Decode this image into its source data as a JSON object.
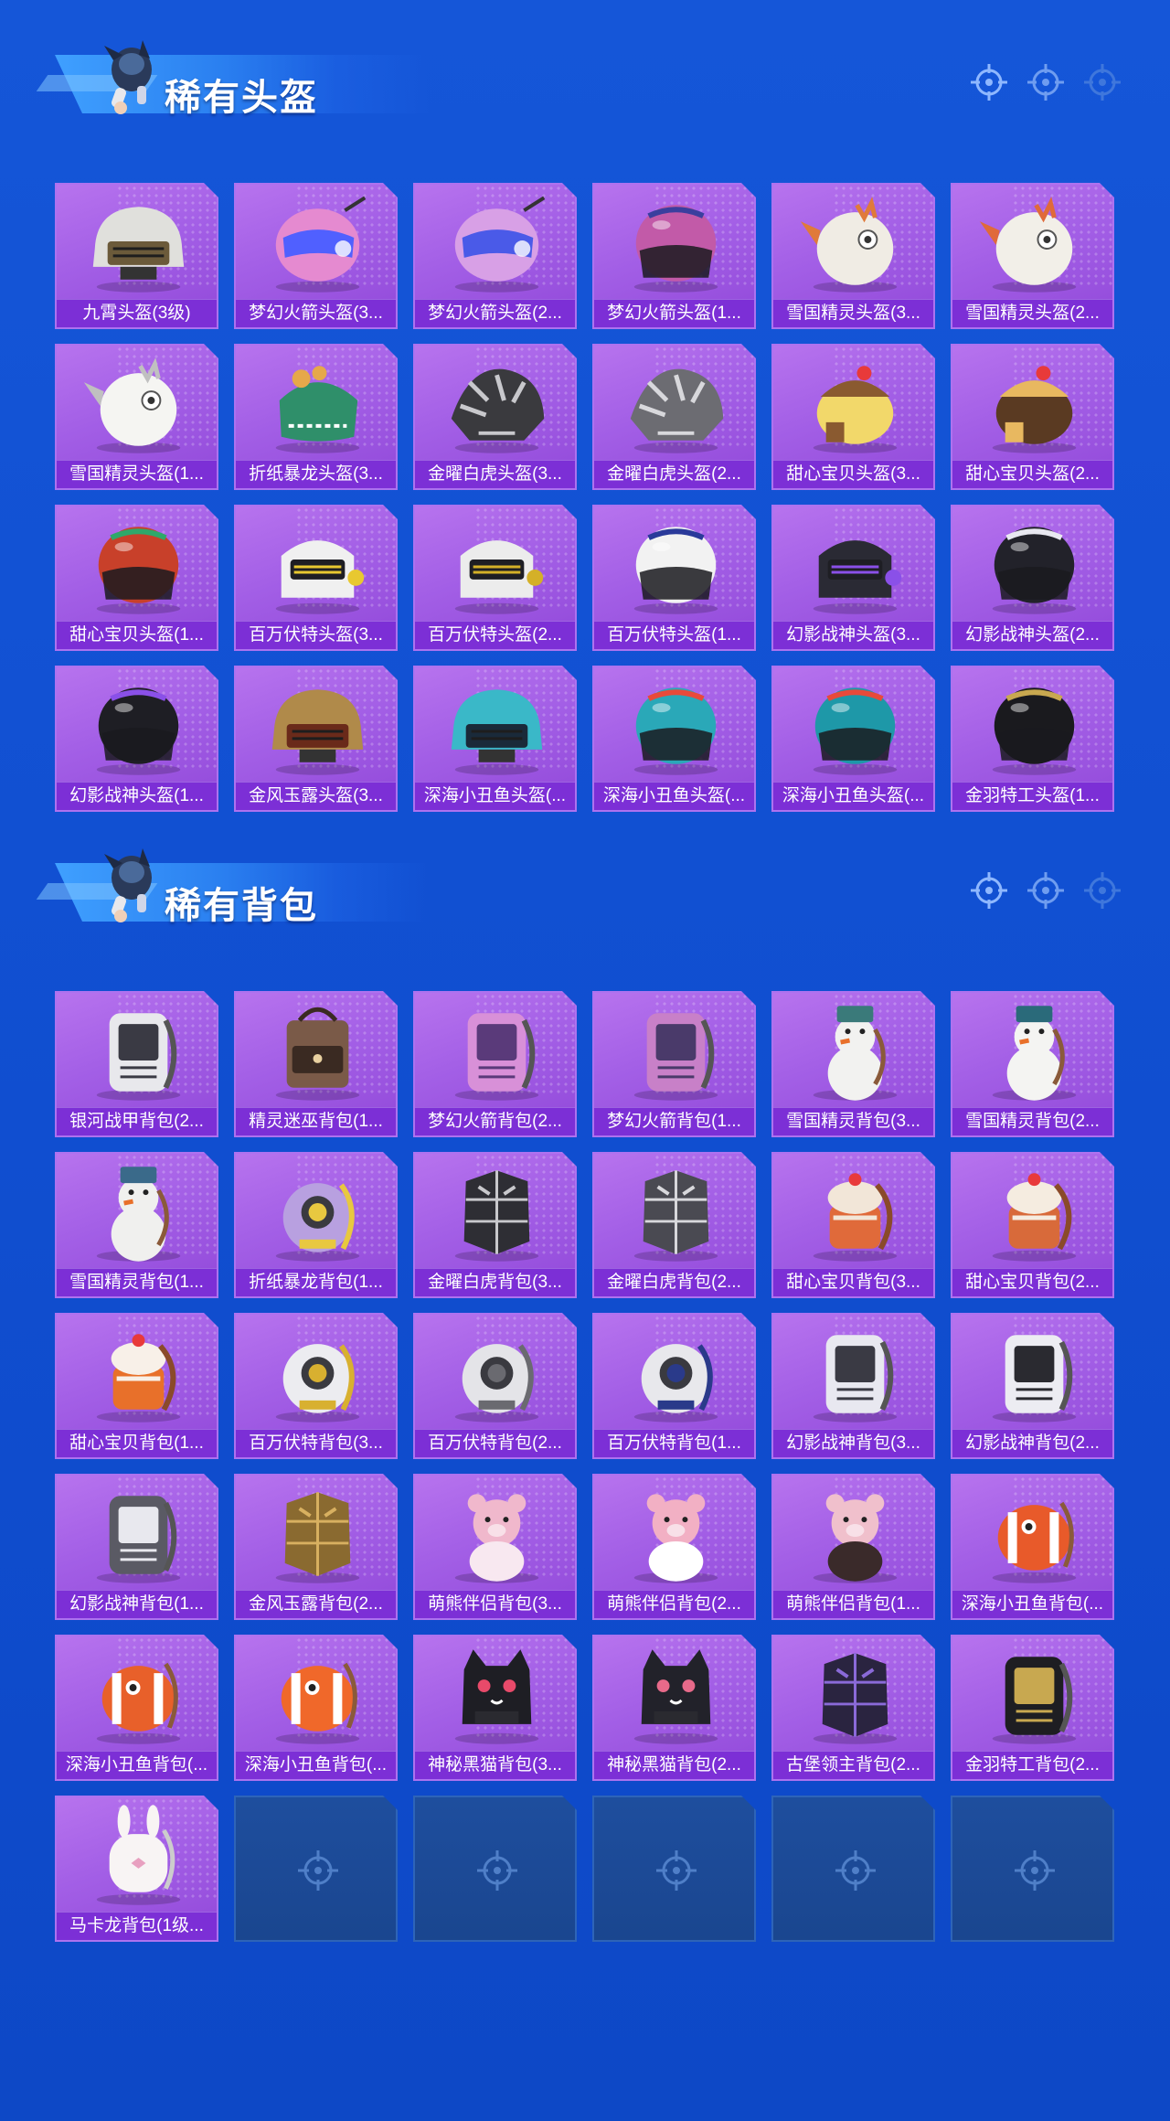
{
  "colors": {
    "background": "#1252d4",
    "card": "#a35fe6",
    "card_label": "#7c2fd6",
    "empty_slot": "#1e4e9e"
  },
  "sections": [
    {
      "title": "稀有头盔",
      "category": "helmet",
      "items": [
        {
          "name": "九霄头盔(3级)",
          "icon": "military-helmet",
          "color": "#e0e0dc",
          "accent": "#6b5a3a"
        },
        {
          "name": "梦幻火箭头盔(3...",
          "icon": "visor-helmet",
          "color": "#e58ad0",
          "accent": "#5060ff"
        },
        {
          "name": "梦幻火箭头盔(2...",
          "icon": "visor-helmet",
          "color": "#d8a0e6",
          "accent": "#4a5ae8"
        },
        {
          "name": "梦幻火箭头盔(1...",
          "icon": "round-helmet",
          "color": "#c25aa8",
          "accent": "#3a3f9e"
        },
        {
          "name": "雪国精灵头盔(3...",
          "icon": "creature-helmet",
          "color": "#f0ece4",
          "accent": "#e07a3a"
        },
        {
          "name": "雪国精灵头盔(2...",
          "icon": "creature-helmet",
          "color": "#f2efe8",
          "accent": "#e06a3a"
        },
        {
          "name": "雪国精灵头盔(1...",
          "icon": "creature-helmet",
          "color": "#f5f5f2",
          "accent": "#c0c0c0"
        },
        {
          "name": "折纸暴龙头盔(3...",
          "icon": "dragon-helmet",
          "color": "#2f8f6a",
          "accent": "#e6a84a"
        },
        {
          "name": "金曜白虎头盔(3...",
          "icon": "tiger-helmet",
          "color": "#3a3a3e",
          "accent": "#c8c8cc"
        },
        {
          "name": "金曜白虎头盔(2...",
          "icon": "tiger-helmet",
          "color": "#6c6c72",
          "accent": "#d8d8dc"
        },
        {
          "name": "甜心宝贝头盔(3...",
          "icon": "dessert-helmet",
          "color": "#f2d86a",
          "accent": "#8a5a30"
        },
        {
          "name": "甜心宝贝头盔(2...",
          "icon": "dessert-helmet",
          "color": "#5a3a22",
          "accent": "#e8b860"
        },
        {
          "name": "甜心宝贝头盔(1...",
          "icon": "round-helmet",
          "color": "#c8402a",
          "accent": "#2ea86a"
        },
        {
          "name": "百万伏特头盔(3...",
          "icon": "robot-helmet",
          "color": "#f0f0f0",
          "accent": "#e8c830"
        },
        {
          "name": "百万伏特头盔(2...",
          "icon": "robot-helmet",
          "color": "#ececec",
          "accent": "#d4b028"
        },
        {
          "name": "百万伏特头盔(1...",
          "icon": "round-helmet",
          "color": "#f2f2f2",
          "accent": "#2a3a9a"
        },
        {
          "name": "幻影战神头盔(3...",
          "icon": "robot-helmet",
          "color": "#2a2a34",
          "accent": "#8a50e8"
        },
        {
          "name": "幻影战神头盔(2...",
          "icon": "round-helmet",
          "color": "#22222a",
          "accent": "#e8e8f0"
        },
        {
          "name": "幻影战神头盔(1...",
          "icon": "round-helmet",
          "color": "#1e1e24",
          "accent": "#8a50e8"
        },
        {
          "name": "金风玉露头盔(3...",
          "icon": "military-helmet",
          "color": "#b08a4a",
          "accent": "#6a2a1a"
        },
        {
          "name": "深海小丑鱼头盔(...",
          "icon": "military-helmet",
          "color": "#3ab8c8",
          "accent": "#1a2a3a"
        },
        {
          "name": "深海小丑鱼头盔(...",
          "icon": "round-helmet",
          "color": "#2aa8b8",
          "accent": "#e84a3a"
        },
        {
          "name": "深海小丑鱼头盔(...",
          "icon": "round-helmet",
          "color": "#1e98a8",
          "accent": "#e84a3a"
        },
        {
          "name": "金羽特工头盔(1...",
          "icon": "round-helmet",
          "color": "#1a1a1e",
          "accent": "#c8a850"
        }
      ],
      "empty_slots": 0
    },
    {
      "title": "稀有背包",
      "category": "backpack",
      "items": [
        {
          "name": "银河战甲背包(2...",
          "icon": "tech-backpack",
          "color": "#e8e8ec",
          "accent": "#3a3a44"
        },
        {
          "name": "精灵迷巫背包(1...",
          "icon": "leather-backpack",
          "color": "#7a5a48",
          "accent": "#3a2a22"
        },
        {
          "name": "梦幻火箭背包(2...",
          "icon": "tech-backpack",
          "color": "#d890d8",
          "accent": "#5a3a7a"
        },
        {
          "name": "梦幻火箭背包(1...",
          "icon": "tech-backpack",
          "color": "#c880c8",
          "accent": "#4a3a6a"
        },
        {
          "name": "雪国精灵背包(3...",
          "icon": "snowman-backpack",
          "color": "#f2f2f0",
          "accent": "#3a7a7a"
        },
        {
          "name": "雪国精灵背包(2...",
          "icon": "snowman-backpack",
          "color": "#f4f4f2",
          "accent": "#2a6a7a"
        },
        {
          "name": "雪国精灵背包(1...",
          "icon": "snowman-backpack",
          "color": "#f0f0ee",
          "accent": "#3a6a8a"
        },
        {
          "name": "折纸暴龙背包(1...",
          "icon": "creature-backpack",
          "color": "#b8a0e0",
          "accent": "#e8c840"
        },
        {
          "name": "金曜白虎背包(3...",
          "icon": "armor-backpack",
          "color": "#2e2e34",
          "accent": "#c8c8cc"
        },
        {
          "name": "金曜白虎背包(2...",
          "icon": "armor-backpack",
          "color": "#4a4a52",
          "accent": "#d8d8dc"
        },
        {
          "name": "甜心宝贝背包(3...",
          "icon": "dessert-backpack",
          "color": "#e06a3a",
          "accent": "#f2e6d8"
        },
        {
          "name": "甜心宝贝背包(2...",
          "icon": "dessert-backpack",
          "color": "#d86a3a",
          "accent": "#f5ece0"
        },
        {
          "name": "甜心宝贝背包(1...",
          "icon": "dessert-backpack",
          "color": "#e8702a",
          "accent": "#f8f0e8"
        },
        {
          "name": "百万伏特背包(3...",
          "icon": "robot-backpack",
          "color": "#ececf0",
          "accent": "#d8b030"
        },
        {
          "name": "百万伏特背包(2...",
          "icon": "robot-backpack",
          "color": "#e4e4e8",
          "accent": "#6a6a70"
        },
        {
          "name": "百万伏特背包(1...",
          "icon": "robot-backpack",
          "color": "#e8e8ec",
          "accent": "#2a3a8a"
        },
        {
          "name": "幻影战神背包(3...",
          "icon": "tech-backpack",
          "color": "#e8e8f0",
          "accent": "#3a3a44"
        },
        {
          "name": "幻影战神背包(2...",
          "icon": "tech-backpack",
          "color": "#ececf2",
          "accent": "#2a2a30"
        },
        {
          "name": "幻影战神背包(1...",
          "icon": "tech-backpack",
          "color": "#5a5a64",
          "accent": "#e8e8ee"
        },
        {
          "name": "金风玉露背包(2...",
          "icon": "armor-backpack",
          "color": "#8a6a30",
          "accent": "#d8b060"
        },
        {
          "name": "萌熊伴侣背包(3...",
          "icon": "bear-backpack",
          "color": "#f0b8cc",
          "accent": "#f8e8f0"
        },
        {
          "name": "萌熊伴侣背包(2...",
          "icon": "bear-backpack",
          "color": "#f2b0c4",
          "accent": "#ffffff"
        },
        {
          "name": "萌熊伴侣背包(1...",
          "icon": "bear-backpack",
          "color": "#f0c0cc",
          "accent": "#3a2a2a"
        },
        {
          "name": "深海小丑鱼背包(...",
          "icon": "fish-backpack",
          "color": "#e85a2a",
          "accent": "#ffffff"
        },
        {
          "name": "深海小丑鱼背包(...",
          "icon": "fish-backpack",
          "color": "#e8602a",
          "accent": "#ffffff"
        },
        {
          "name": "深海小丑鱼背包(...",
          "icon": "fish-backpack",
          "color": "#f0682a",
          "accent": "#ffffff"
        },
        {
          "name": "神秘黑猫背包(3...",
          "icon": "cat-backpack",
          "color": "#1e1e24",
          "accent": "#e84a6a"
        },
        {
          "name": "神秘黑猫背包(2...",
          "icon": "cat-backpack",
          "color": "#22222a",
          "accent": "#e86a8a"
        },
        {
          "name": "古堡领主背包(2...",
          "icon": "armor-backpack",
          "color": "#2a2440",
          "accent": "#8a6ad8"
        },
        {
          "name": "金羽特工背包(2...",
          "icon": "tech-backpack",
          "color": "#1e1e22",
          "accent": "#c8a850"
        },
        {
          "name": "马卡龙背包(1级...",
          "icon": "bunny-backpack",
          "color": "#f8f4f4",
          "accent": "#e8a0c0"
        }
      ],
      "empty_slots": 5
    }
  ]
}
